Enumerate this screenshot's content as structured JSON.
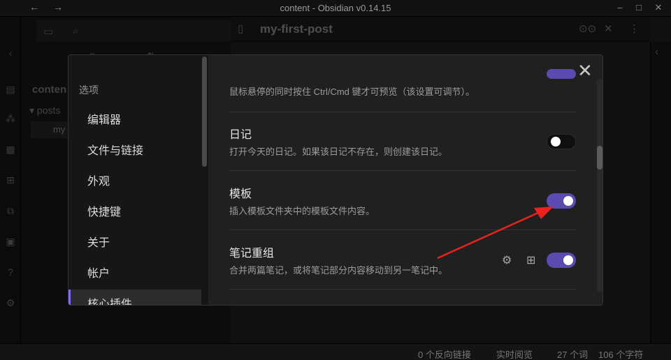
{
  "window": {
    "title": "content - Obsidian v0.14.15",
    "back_icon": "arrow-left-icon",
    "forward_icon": "arrow-right-icon",
    "minimize_icon": "minimize-icon",
    "maximize_icon": "maximize-icon",
    "close_icon": "close-window-icon"
  },
  "file_pane": {
    "vault_name": "conten",
    "folder_name": "posts",
    "file_name": "my"
  },
  "editor": {
    "doc_title": "my-first-post"
  },
  "statusbar": {
    "backlinks": "0 个反向链接",
    "preview_mode": "实时阅览",
    "words": "27 个词",
    "chars": "106 个字符"
  },
  "settings_modal": {
    "sidebar_heading": "选项",
    "sidebar_items": [
      {
        "label": "编辑器"
      },
      {
        "label": "文件与链接"
      },
      {
        "label": "外观"
      },
      {
        "label": "快捷键"
      },
      {
        "label": "关于"
      },
      {
        "label": "帐户"
      },
      {
        "label": "核心插件"
      }
    ],
    "active_item": "核心插件",
    "settings": [
      {
        "name": "",
        "desc": "鼠标悬停的同时按住 Ctrl/Cmd 键才可预览（该设置可调节）。",
        "enabled": true
      },
      {
        "name": "日记",
        "desc": "打开今天的日记。如果该日记不存在，则创建该日记。",
        "enabled": false
      },
      {
        "name": "模板",
        "desc": "插入模板文件夹中的模板文件内容。",
        "enabled": true
      },
      {
        "name": "笔记重组",
        "desc": "合并两篇笔记，或将笔记部分内容移动到另一笔记中。",
        "enabled": true,
        "icons": [
          "gear-icon",
          "hotkey-icon"
        ]
      }
    ]
  },
  "colors": {
    "accent": "#7f6df2",
    "toggle_on": "#5b4bb0",
    "annotation_arrow": "#e8231d"
  }
}
